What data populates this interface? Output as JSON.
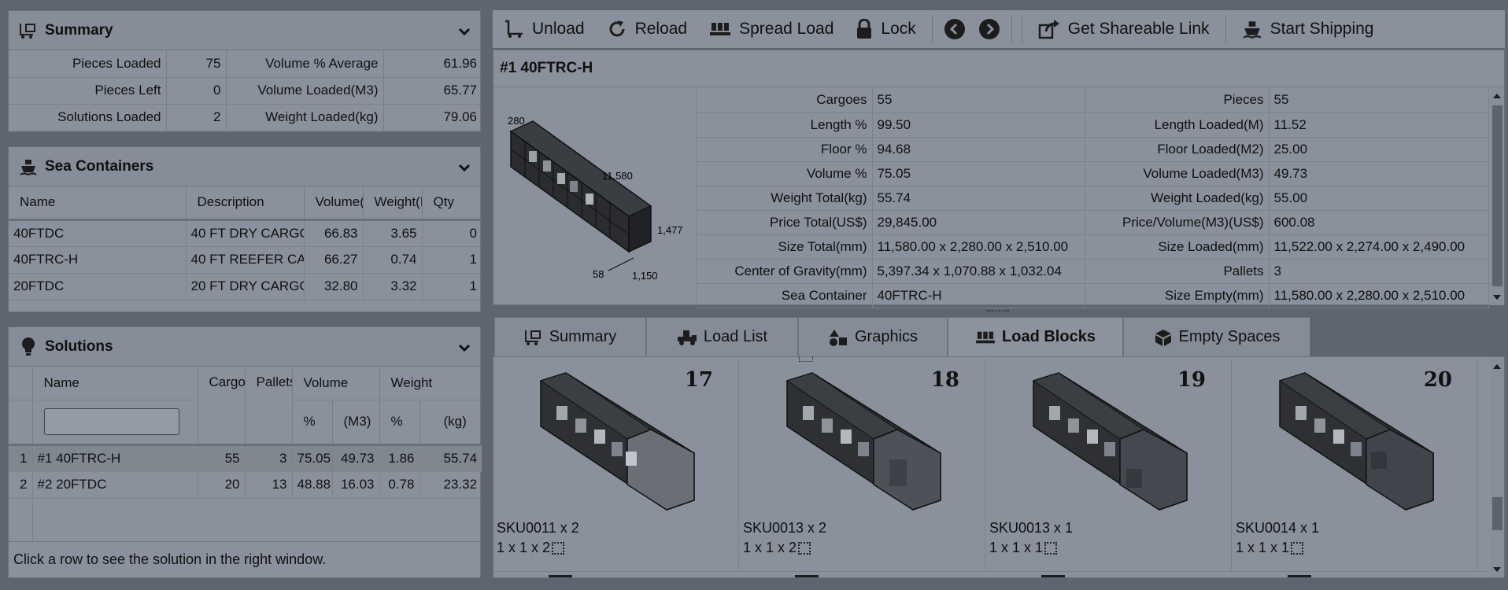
{
  "summary_panel": {
    "title": "Summary",
    "rows": [
      {
        "label1": "Pieces Loaded",
        "value1": "75",
        "label2": "Volume % Average",
        "value2": "61.96"
      },
      {
        "label1": "Pieces Left",
        "value1": "0",
        "label2": "Volume Loaded(M3)",
        "value2": "65.77"
      },
      {
        "label1": "Solutions Loaded",
        "value1": "2",
        "label2": "Weight Loaded(kg)",
        "value2": "79.06"
      }
    ]
  },
  "containers_panel": {
    "title": "Sea Containers",
    "columns": [
      "Name",
      "Description",
      "Volume(",
      "Weight(I",
      "Qty"
    ],
    "rows": [
      {
        "name": "40FTDC",
        "description": "40 FT DRY CARGC",
        "volume": "66.83",
        "weight": "3.65",
        "qty": "0"
      },
      {
        "name": "40FTRC-H",
        "description": "40 FT REEFER CA",
        "volume": "66.27",
        "weight": "0.74",
        "qty": "1"
      },
      {
        "name": "20FTDC",
        "description": "20 FT DRY CARGC",
        "volume": "32.80",
        "weight": "3.32",
        "qty": "1"
      }
    ]
  },
  "solutions_panel": {
    "title": "Solutions",
    "col_name": "Name",
    "col_cargo": "Cargo",
    "col_pallets": "Pallets",
    "col_volume": "Volume",
    "col_weight": "Weight",
    "sub_pct": "%",
    "sub_m3": "(M3)",
    "sub_pct2": "%",
    "sub_kg": "(kg)",
    "filter_placeholder": "",
    "rows": [
      {
        "idx": "1",
        "name": "#1 40FTRC-H",
        "cargo": "55",
        "pallets": "3",
        "vol_pct": "75.05",
        "vol_m3": "49.73",
        "wt_pct": "1.86",
        "wt_kg": "55.74"
      },
      {
        "idx": "2",
        "name": "#2 20FTDC",
        "cargo": "20",
        "pallets": "13",
        "vol_pct": "48.88",
        "vol_m3": "16.03",
        "wt_pct": "0.78",
        "wt_kg": "23.32"
      }
    ],
    "hint": "Click a row to see the solution in the right window."
  },
  "toolbar": {
    "unload": "Unload",
    "reload": "Reload",
    "spread_load": "Spread Load",
    "lock": "Lock",
    "share": "Get Shareable Link",
    "start_shipping": "Start Shipping"
  },
  "detail": {
    "title": "#1 40FTRC-H",
    "diagram_labels": {
      "top": "280",
      "length": "11,580",
      "height": "1,477",
      "left_bottom": "58",
      "width": "1,150"
    },
    "rows": [
      {
        "l1": "Cargoes",
        "v1": "55",
        "l2": "Pieces",
        "v2": "55"
      },
      {
        "l1": "Length %",
        "v1": "99.50",
        "l2": "Length Loaded(M)",
        "v2": "11.52"
      },
      {
        "l1": "Floor %",
        "v1": "94.68",
        "l2": "Floor Loaded(M2)",
        "v2": "25.00"
      },
      {
        "l1": "Volume %",
        "v1": "75.05",
        "l2": "Volume Loaded(M3)",
        "v2": "49.73"
      },
      {
        "l1": "Weight Total(kg)",
        "v1": "55.74",
        "l2": "Weight Loaded(kg)",
        "v2": "55.00"
      },
      {
        "l1": "Price Total(US$)",
        "v1": "29,845.00",
        "l2": "Price/Volume(M3)(US$)",
        "v2": "600.08"
      },
      {
        "l1": "Size Total(mm)",
        "v1": "11,580.00 x 2,280.00 x 2,510.00",
        "l2": "Size Loaded(mm)",
        "v2": "11,522.00 x 2,274.00 x 2,490.00"
      },
      {
        "l1": "Center of Gravity(mm)",
        "v1": "5,397.34 x 1,070.88 x 1,032.04",
        "l2": "Pallets",
        "v2": "3"
      },
      {
        "l1": "Sea Container",
        "v1": "40FTRC-H",
        "l2": "Size Empty(mm)",
        "v2": "11,580.00 x 2,280.00 x 2,510.00"
      }
    ]
  },
  "tabs": [
    "Summary",
    "Load List",
    "Graphics",
    "Load Blocks",
    "Empty Spaces"
  ],
  "active_tab": "Load Blocks",
  "blocks": [
    {
      "num": "17",
      "sku": "SKU0011 x 2",
      "dims": "1 x 1 x 2"
    },
    {
      "num": "18",
      "sku": "SKU0013 x 2",
      "dims": "1 x 1 x 2"
    },
    {
      "num": "19",
      "sku": "SKU0013 x 1",
      "dims": "1 x 1 x 1"
    },
    {
      "num": "20",
      "sku": "SKU0014 x 1",
      "dims": "1 x 1 x 1"
    }
  ]
}
